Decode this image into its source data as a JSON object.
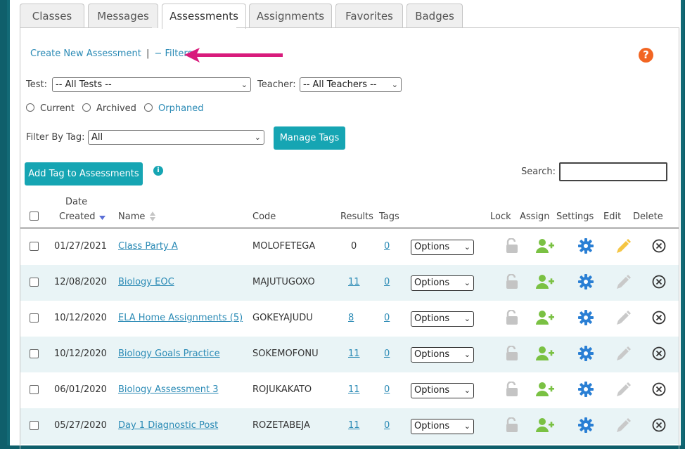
{
  "tabs": [
    "Classes",
    "Messages",
    "Assessments",
    "Assignments",
    "Favorites",
    "Badges"
  ],
  "active_tab": "Assessments",
  "top_links": {
    "create": "Create New Assessment",
    "separator": "|",
    "filters": "− Filters"
  },
  "help_icon": "?",
  "filters": {
    "test_label": "Test:",
    "test_value": "-- All Tests --",
    "teacher_label": "Teacher:",
    "teacher_value": "-- All Teachers --",
    "radios": [
      "Current",
      "Archived",
      "Orphaned"
    ],
    "tag_label": "Filter By Tag:",
    "tag_value": "All",
    "manage_tags": "Manage Tags"
  },
  "add_tag_button": "Add Tag to Assessments",
  "info_icon": "i",
  "search_label": "Search:",
  "table": {
    "headers": {
      "date_line1": "Date",
      "date_line2": "Created",
      "name": "Name",
      "code": "Code",
      "results": "Results",
      "tags": "Tags",
      "lock": "Lock",
      "assign": "Assign",
      "settings": "Settings",
      "edit": "Edit",
      "delete": "Delete"
    },
    "rows": [
      {
        "date": "01/27/2021",
        "name": "Class Party A",
        "code": "MOLOFETEGA",
        "results": "0",
        "tags": "0",
        "options": "Options"
      },
      {
        "date": "12/08/2020",
        "name": "Biology EOC",
        "code": "MAJUTUGOXO",
        "results": "11",
        "tags": "0",
        "options": "Options"
      },
      {
        "date": "10/12/2020",
        "name": "ELA Home Assignments (5)",
        "code": "GOKEYAJUDU",
        "results": "8",
        "tags": "0",
        "options": "Options"
      },
      {
        "date": "10/12/2020",
        "name": "Biology Goals Practice",
        "code": "SOKEMOFONU",
        "results": "11",
        "tags": "0",
        "options": "Options"
      },
      {
        "date": "06/01/2020",
        "name": "Biology Assessment 3",
        "code": "ROJUKAKATO",
        "results": "11",
        "tags": "0",
        "options": "Options"
      },
      {
        "date": "05/27/2020",
        "name": "Day 1 Diagnostic Post",
        "code": "ROZETABEJA",
        "results": "11",
        "tags": "0",
        "options": "Options"
      }
    ]
  },
  "colors": {
    "accent": "#16a5b3",
    "link": "#2a8ab5",
    "assign_icon": "#7ac143",
    "settings_icon": "#2a7fd4",
    "edit_icon_active": "#f5c542",
    "help": "#f26522",
    "arrow": "#d81b7c"
  }
}
